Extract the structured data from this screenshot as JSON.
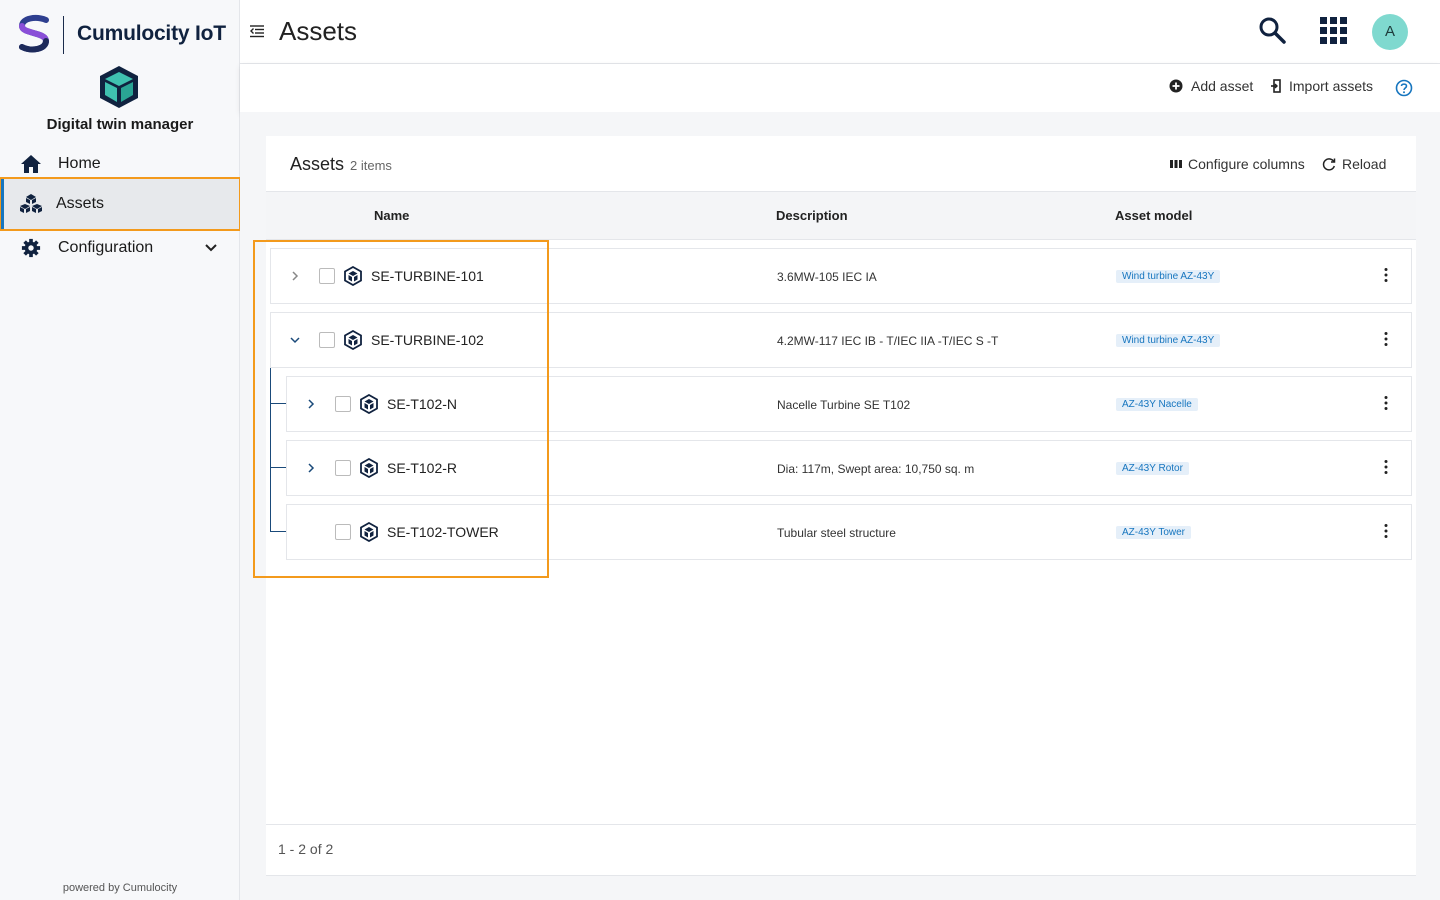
{
  "brand": {
    "title": "Cumulocity IoT",
    "app_name": "Digital twin manager"
  },
  "nav": {
    "home": "Home",
    "assets": "Assets",
    "configuration": "Configuration"
  },
  "powered_by": "powered by Cumulocity",
  "header": {
    "title": "Assets",
    "avatar_initial": "A"
  },
  "actions": {
    "add_asset": "Add asset",
    "import_assets": "Import assets"
  },
  "card": {
    "title": "Assets",
    "count": "2 items",
    "configure_columns": "Configure columns",
    "reload": "Reload"
  },
  "columns": {
    "name": "Name",
    "description": "Description",
    "asset_model": "Asset model"
  },
  "rows": [
    {
      "name": "SE-TURBINE-101",
      "description": "3.6MW-105 IEC IA",
      "model": "Wind turbine AZ-43Y",
      "level": 0,
      "expandable": true,
      "expanded": false
    },
    {
      "name": "SE-TURBINE-102",
      "description": "4.2MW-117 IEC IB - T/IEC IIA -T/IEC S -T",
      "model": "Wind turbine AZ-43Y",
      "level": 0,
      "expandable": true,
      "expanded": true
    },
    {
      "name": "SE-T102-N",
      "description": "Nacelle Turbine SE T102",
      "model": "AZ-43Y Nacelle",
      "level": 1,
      "expandable": true,
      "expanded": false
    },
    {
      "name": "SE-T102-R",
      "description": "Dia: 117m, Swept area: 10,750 sq. m",
      "model": "AZ-43Y Rotor",
      "level": 1,
      "expandable": true,
      "expanded": false
    },
    {
      "name": "SE-T102-TOWER",
      "description": "Tubular steel structure",
      "model": "AZ-43Y Tower",
      "level": 1,
      "expandable": false,
      "expanded": false
    }
  ],
  "pager": "1 - 2 of 2",
  "colors": {
    "accent": "#1776bf",
    "highlight": "#f39a1c",
    "avatar": "#7fd9cf"
  }
}
